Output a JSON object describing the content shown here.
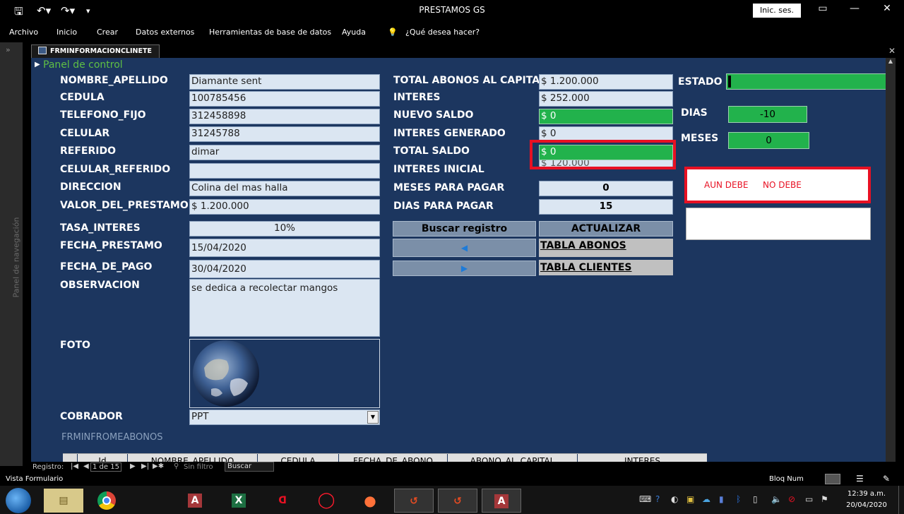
{
  "app": {
    "title": "PRESTAMOS GS",
    "signin": "Inic. ses.",
    "menu": [
      "Archivo",
      "Inicio",
      "Crear",
      "Datos externos",
      "Herramientas de base de datos",
      "Ayuda",
      "¿Qué desea hacer?"
    ],
    "nav_pane_label": "Panel de navegación",
    "doc_tab": "FRMINFORMACIONCLINETE"
  },
  "form": {
    "panel_link": "Panel de control",
    "left": [
      {
        "label": "NOMBRE_APELLIDO",
        "value": "Diamante sent"
      },
      {
        "label": "CEDULA",
        "value": "100785456"
      },
      {
        "label": "TELEFONO_FIJO",
        "value": "312458898"
      },
      {
        "label": "CELULAR",
        "value": "31245788"
      },
      {
        "label": "REFERIDO",
        "value": "dimar"
      },
      {
        "label": "CELULAR_REFERIDO",
        "value": ""
      },
      {
        "label": "DIRECCION",
        "value": "Colina del mas halla"
      },
      {
        "label": "VALOR_DEL_PRESTAMO",
        "value": "$ 1.200.000"
      },
      {
        "label": "TASA_INTERES",
        "value": "10%"
      },
      {
        "label": "FECHA_PRESTAMO",
        "value": "15/04/2020"
      },
      {
        "label": "FECHA_DE_PAGO",
        "value": "30/04/2020"
      },
      {
        "label": "OBSERVACION",
        "value": "se dedica a recolectar mangos"
      }
    ],
    "foto_label": "FOTO",
    "cobrador_label": "COBRADOR",
    "cobrador_value": "PPT",
    "middle": [
      {
        "label": "TOTAL ABONOS AL CAPITAL",
        "value": "$ 1.200.000"
      },
      {
        "label": "INTERES",
        "value": "$ 252.000"
      },
      {
        "label": "NUEVO SALDO",
        "value": "$ 0"
      },
      {
        "label": "INTERES GENERADO",
        "value": "$ 0"
      },
      {
        "label": "TOTAL SALDO",
        "value": "$ 0"
      },
      {
        "label": "INTERES INICIAL",
        "value": "$ 120.000"
      },
      {
        "label": "MESES PARA PAGAR",
        "value": "0"
      },
      {
        "label": "DIAS PARA PAGAR",
        "value": "15"
      }
    ],
    "buttons": {
      "search": "Buscar registro",
      "update": "ACTUALIZAR",
      "prev": "◀",
      "next": "▶",
      "tabla_abonos": "TABLA ABONOS",
      "tabla_clientes": "TABLA CLIENTES"
    },
    "estado_label": "ESTADO",
    "dias_label": "DIAS",
    "dias_value": "-10",
    "meses_label": "MESES",
    "meses_value": "0",
    "aun_debe": "AUN DEBE",
    "no_debe": "NO DEBE",
    "subform_label": "FRMINFROMEABONOS",
    "subform_columns": [
      "Id",
      "NOMBRE_APELLIDO",
      "CEDULA",
      "FECHA_DE_ABONO",
      "ABONO_AL_CAPITAL",
      "INTERES"
    ]
  },
  "recordbar": {
    "label": "Registro:",
    "current": "1 de 15",
    "filter": "Sin filtro",
    "search": "Buscar"
  },
  "status": {
    "view": "Vista Formulario",
    "numlock": "Bloq Num"
  },
  "taskbar": {
    "time": "12:39 a.m.",
    "date": "20/04/2020"
  },
  "colors": {
    "form_bg": "#1c365f",
    "green": "#22b24c",
    "red_highlight": "#e81123"
  }
}
